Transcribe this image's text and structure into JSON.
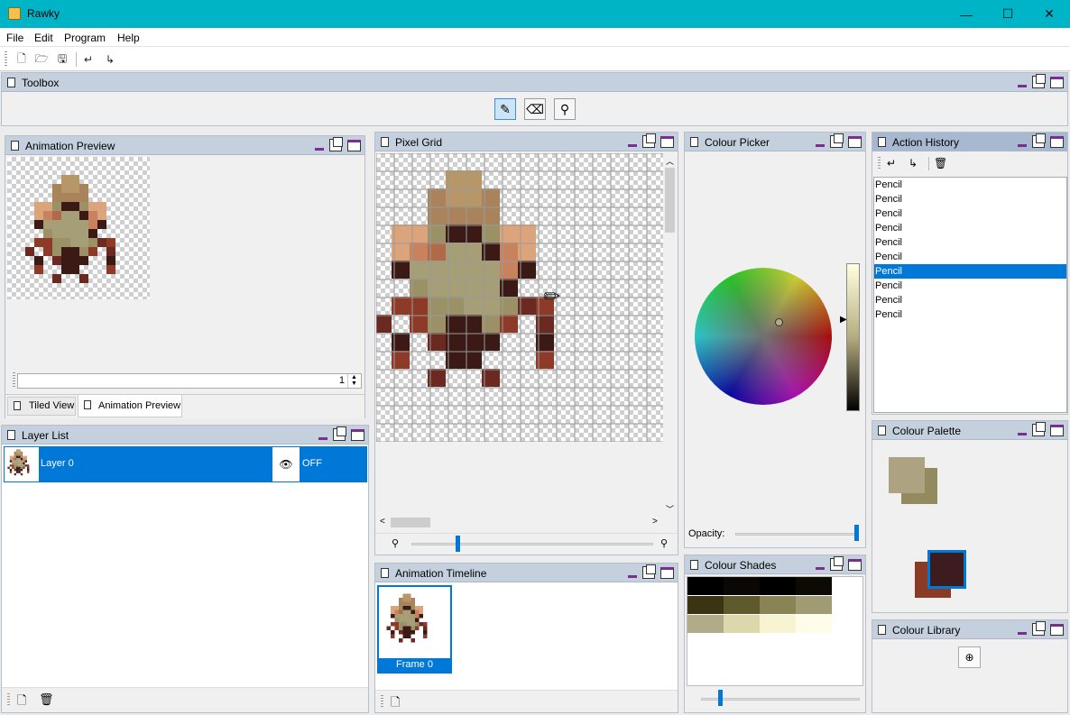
{
  "window": {
    "title": "Rawky",
    "minimize": "—",
    "maximize": "☐",
    "close": "✕"
  },
  "menu": {
    "items": [
      "File",
      "Edit",
      "Program",
      "Help"
    ]
  },
  "toolbar": {
    "icons": [
      "new-file-icon",
      "open-folder-icon",
      "save-icon",
      "undo-icon",
      "redo-icon"
    ]
  },
  "toolbox": {
    "title": "Toolbox",
    "tools": [
      {
        "name": "pencil",
        "glyph": "✎",
        "active": true
      },
      {
        "name": "eraser",
        "glyph": "⌫",
        "active": false
      },
      {
        "name": "eyedropper",
        "glyph": "⚲",
        "active": false
      }
    ]
  },
  "animation_preview": {
    "title": "Animation Preview",
    "spinner_value": "1",
    "tabs": [
      "Tiled View",
      "Animation Preview"
    ],
    "active_tab": 1
  },
  "layer_list": {
    "title": "Layer List",
    "layers": [
      {
        "name": "Layer 0",
        "visibility": "OFF"
      }
    ]
  },
  "pixel_grid": {
    "title": "Pixel Grid"
  },
  "animation_timeline": {
    "title": "Animation Timeline",
    "frames": [
      "Frame 0"
    ]
  },
  "colour_picker": {
    "title": "Colour Picker",
    "opacity_label": "Opacity:",
    "opacity": 1.0
  },
  "colour_shades": {
    "title": "Colour Shades",
    "shades": [
      "#000000",
      "#0a0704",
      "#000000",
      "#0d0a04",
      "#3b3413",
      "#5f5a2c",
      "#8a8455",
      "#a09b72",
      "#b2ab89",
      "#ddd7ae",
      "#f8f4d1",
      "#fffde9",
      "#ffffff",
      "#ffffff"
    ]
  },
  "action_history": {
    "title": "Action History",
    "items": [
      "Pencil",
      "Pencil",
      "Pencil",
      "Pencil",
      "Pencil",
      "Pencil",
      "Pencil",
      "Pencil",
      "Pencil",
      "Pencil"
    ],
    "selected_index": 6
  },
  "colour_palette": {
    "title": "Colour Palette",
    "colors": {
      "primary_back": "#ada383",
      "primary_front": "#938b5e",
      "secondary_back": "#8b3a26",
      "secondary_front": "#3d1c20"
    }
  },
  "colour_library": {
    "title": "Colour Library"
  },
  "sprite": {
    "palette": {
      ".": null,
      "a": "#a8835c",
      "b": "#b79767",
      "c": "#dca47a",
      "d": "#c9825e",
      "e": "#b06a4a",
      "f": "#8c8a63",
      "g": "#a69e76",
      "h": "#3b1a15",
      "i": "#6a2a22",
      "j": "#8e3a28",
      "k": "#9a9266"
    },
    "rows": [
      "..........................",
      "..........................",
      ".........bb...........",
      "........abba..........",
      "........aaaa..........",
      "......cckhhkcc........",
      "......cdegghdc........",
      "......hgggggdh........",
      ".......kggggh.........",
      "......jjkkggkij.......",
      ".....i.jkhhkj.i.......",
      "......h.ihhh..h.......",
      "......j..hh...j.......",
      "........i..i..........",
      ".........................."
    ]
  }
}
